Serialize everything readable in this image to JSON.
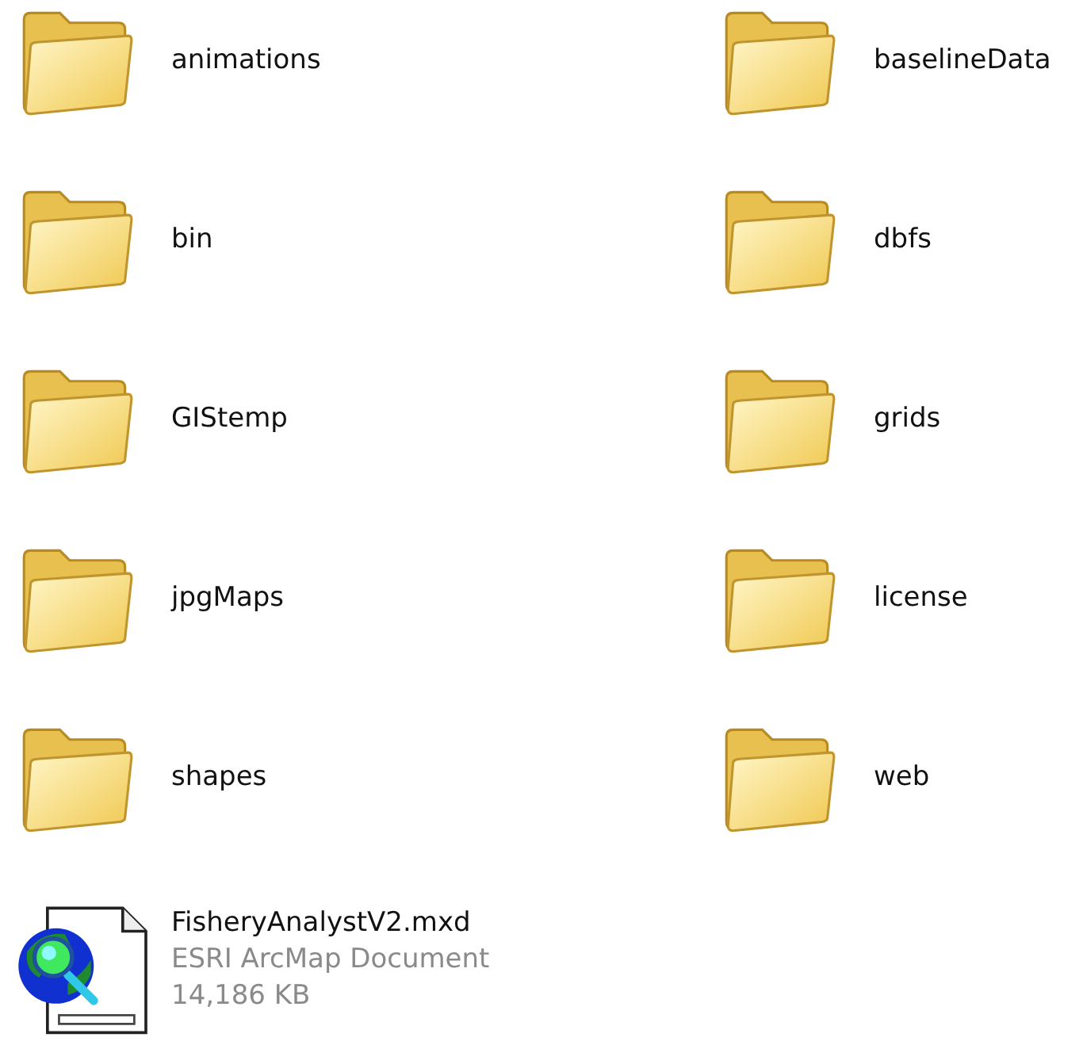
{
  "items": [
    {
      "kind": "folder",
      "name": "animations"
    },
    {
      "kind": "folder",
      "name": "baselineData"
    },
    {
      "kind": "folder",
      "name": "bin"
    },
    {
      "kind": "folder",
      "name": "dbfs"
    },
    {
      "kind": "folder",
      "name": "GIStemp"
    },
    {
      "kind": "folder",
      "name": "grids"
    },
    {
      "kind": "folder",
      "name": "jpgMaps"
    },
    {
      "kind": "folder",
      "name": "license"
    },
    {
      "kind": "folder",
      "name": "shapes"
    },
    {
      "kind": "folder",
      "name": "web"
    },
    {
      "kind": "file",
      "name": "FisheryAnalystV2.mxd",
      "type": "ESRI ArcMap Document",
      "size": "14,186 KB"
    }
  ]
}
